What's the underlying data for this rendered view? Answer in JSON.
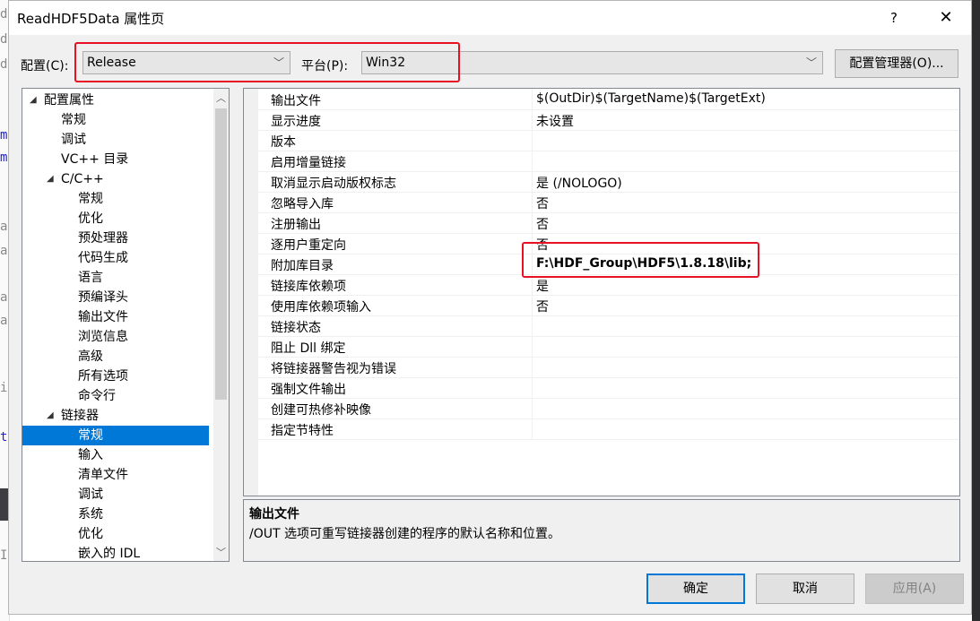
{
  "background": {
    "left_chars": [
      "d",
      "d",
      "d",
      "m",
      "m",
      "a",
      "a",
      "a",
      "a",
      "i",
      "t",
      "I"
    ]
  },
  "dialog": {
    "title": "ReadHDF5Data 属性页",
    "help_label": "?",
    "close_label": "✕"
  },
  "config": {
    "config_label": "配置(C):",
    "config_value": "Release",
    "platform_label": "平台(P):",
    "platform_value": "Win32",
    "manager_button": "配置管理器(O)..."
  },
  "tree": {
    "items": [
      {
        "label": "配置属性",
        "expander": "◢"
      },
      {
        "label": "常规"
      },
      {
        "label": "调试"
      },
      {
        "label": "VC++ 目录"
      },
      {
        "label": "C/C++",
        "expander": "◢"
      },
      {
        "label": "常规"
      },
      {
        "label": "优化"
      },
      {
        "label": "预处理器"
      },
      {
        "label": "代码生成"
      },
      {
        "label": "语言"
      },
      {
        "label": "预编译头"
      },
      {
        "label": "输出文件"
      },
      {
        "label": "浏览信息"
      },
      {
        "label": "高级"
      },
      {
        "label": "所有选项"
      },
      {
        "label": "命令行"
      },
      {
        "label": "链接器",
        "expander": "◢"
      },
      {
        "label": "常规",
        "selected": true
      },
      {
        "label": "输入"
      },
      {
        "label": "清单文件"
      },
      {
        "label": "调试"
      },
      {
        "label": "系统"
      },
      {
        "label": "优化"
      },
      {
        "label": "嵌入的 IDL"
      }
    ]
  },
  "grid": {
    "rows": [
      {
        "name": "输出文件",
        "value": "$(OutDir)$(TargetName)$(TargetExt)"
      },
      {
        "name": "显示进度",
        "value": "未设置"
      },
      {
        "name": "版本",
        "value": ""
      },
      {
        "name": "启用增量链接",
        "value": ""
      },
      {
        "name": "取消显示启动版权标志",
        "value": "是 (/NOLOGO)"
      },
      {
        "name": "忽略导入库",
        "value": "否"
      },
      {
        "name": "注册输出",
        "value": "否"
      },
      {
        "name": "逐用户重定向",
        "value": "否"
      },
      {
        "name": "附加库目录",
        "value": "F:\\HDF_Group\\HDF5\\1.8.18\\lib;",
        "bold": true
      },
      {
        "name": "链接库依赖项",
        "value": "是"
      },
      {
        "name": "使用库依赖项输入",
        "value": "否"
      },
      {
        "name": "链接状态",
        "value": ""
      },
      {
        "name": "阻止 Dll 绑定",
        "value": ""
      },
      {
        "name": "将链接器警告视为错误",
        "value": ""
      },
      {
        "name": "强制文件输出",
        "value": ""
      },
      {
        "name": "创建可热修补映像",
        "value": ""
      },
      {
        "name": "指定节特性",
        "value": ""
      }
    ]
  },
  "description": {
    "title": "输出文件",
    "text": "/OUT 选项可重写链接器创建的程序的默认名称和位置。"
  },
  "buttons": {
    "ok": "确定",
    "cancel": "取消",
    "apply": "应用(A)"
  },
  "colors": {
    "highlight_red": "#e81123",
    "selection_blue": "#0078d7"
  }
}
